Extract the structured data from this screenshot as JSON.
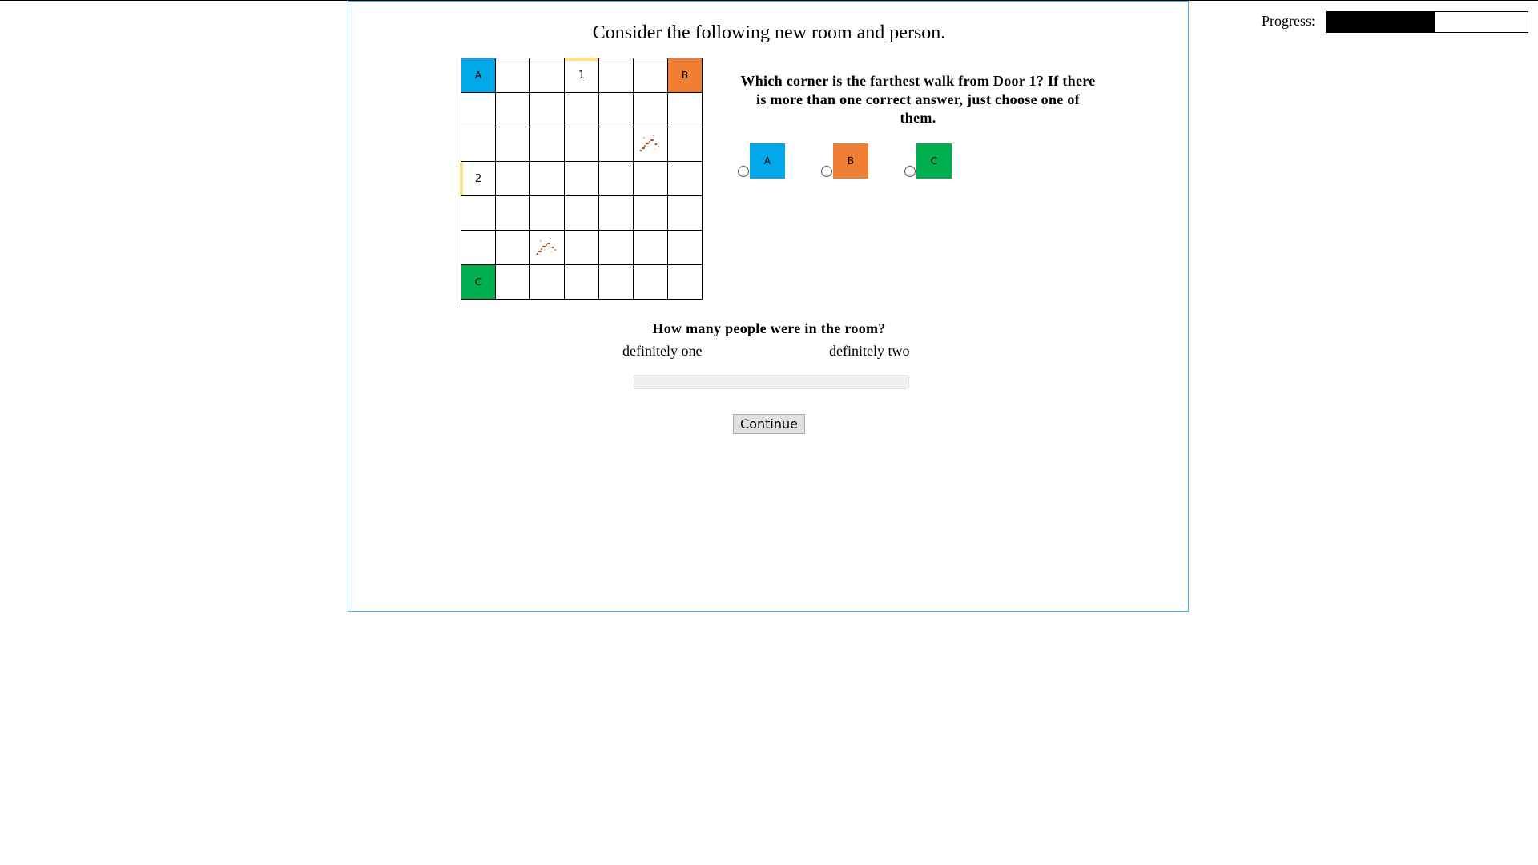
{
  "header": {
    "title": "Consider the following new room and person."
  },
  "progress": {
    "label": "Progress:",
    "fraction": 0.54
  },
  "room": {
    "rows": 7,
    "cols": 7,
    "corners": [
      {
        "label": "A",
        "row": 0,
        "col": 0,
        "color": "#00a8e8"
      },
      {
        "label": "B",
        "row": 0,
        "col": 6,
        "color": "#ef7f34"
      },
      {
        "label": "C",
        "row": 6,
        "col": 0,
        "color": "#00b050"
      }
    ],
    "doors": [
      {
        "label": "1",
        "row": 0,
        "col": 3,
        "side": "top"
      },
      {
        "label": "2",
        "row": 3,
        "col": 0,
        "side": "left"
      }
    ],
    "footprints": [
      {
        "row": 2,
        "col": 5,
        "icon": "footprints-icon"
      },
      {
        "row": 5,
        "col": 2,
        "icon": "footprints-icon"
      }
    ],
    "door_color": "#ffe082"
  },
  "question": {
    "text": "Which corner is the farthest walk from Door 1? If there is more than one correct answer, just choose one of them.",
    "options": [
      {
        "label": "A",
        "color": "#00a8e8",
        "selected": false
      },
      {
        "label": "B",
        "color": "#ef7f34",
        "selected": false
      },
      {
        "label": "C",
        "color": "#00b050",
        "selected": false
      }
    ]
  },
  "people": {
    "question": "How many people were in the room?",
    "left_label": "definitely one",
    "right_label": "definitely two"
  },
  "continue_label": "Continue"
}
